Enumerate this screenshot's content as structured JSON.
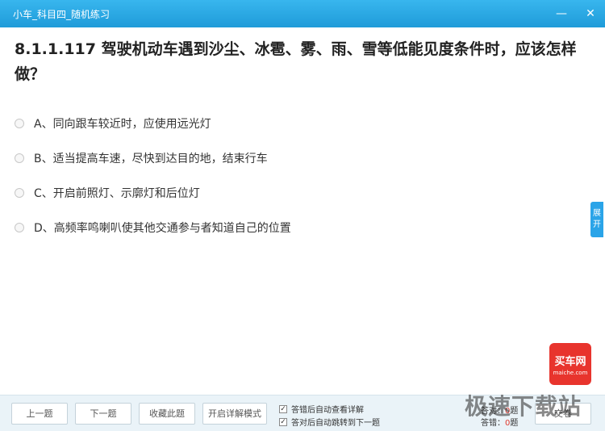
{
  "window": {
    "title": "小车_科目四_随机练习",
    "minimize_glyph": "—",
    "close_glyph": "✕"
  },
  "question": {
    "text": "8.1.1.117 驾驶机动车遇到沙尘、冰雹、雾、雨、雪等低能见度条件时，应该怎样做？"
  },
  "options": [
    {
      "label": "A、同向跟车较近时，应使用远光灯"
    },
    {
      "label": "B、适当提高车速，尽快到达目的地，结束行车"
    },
    {
      "label": "C、开启前照灯、示廓灯和后位灯"
    },
    {
      "label": "D、高频率鸣喇叭使其他交通参与者知道自己的位置"
    }
  ],
  "side_tab": {
    "line1": "展",
    "line2": "开"
  },
  "logo": {
    "cn": "买车网",
    "en": "maiche.com"
  },
  "bottom": {
    "prev": "上一题",
    "next": "下一题",
    "favorite": "收藏此题",
    "detail_mode": "开启详解模式",
    "check1": "答错后自动查看详解",
    "check2": "答对后自动跳转到下一题",
    "correct_label": "答对：",
    "correct_count": "0",
    "correct_suffix": "题",
    "wrong_label": "答错：",
    "wrong_count": "0",
    "wrong_suffix": "题",
    "submit": "交卷"
  },
  "watermark": "极速下载站"
}
